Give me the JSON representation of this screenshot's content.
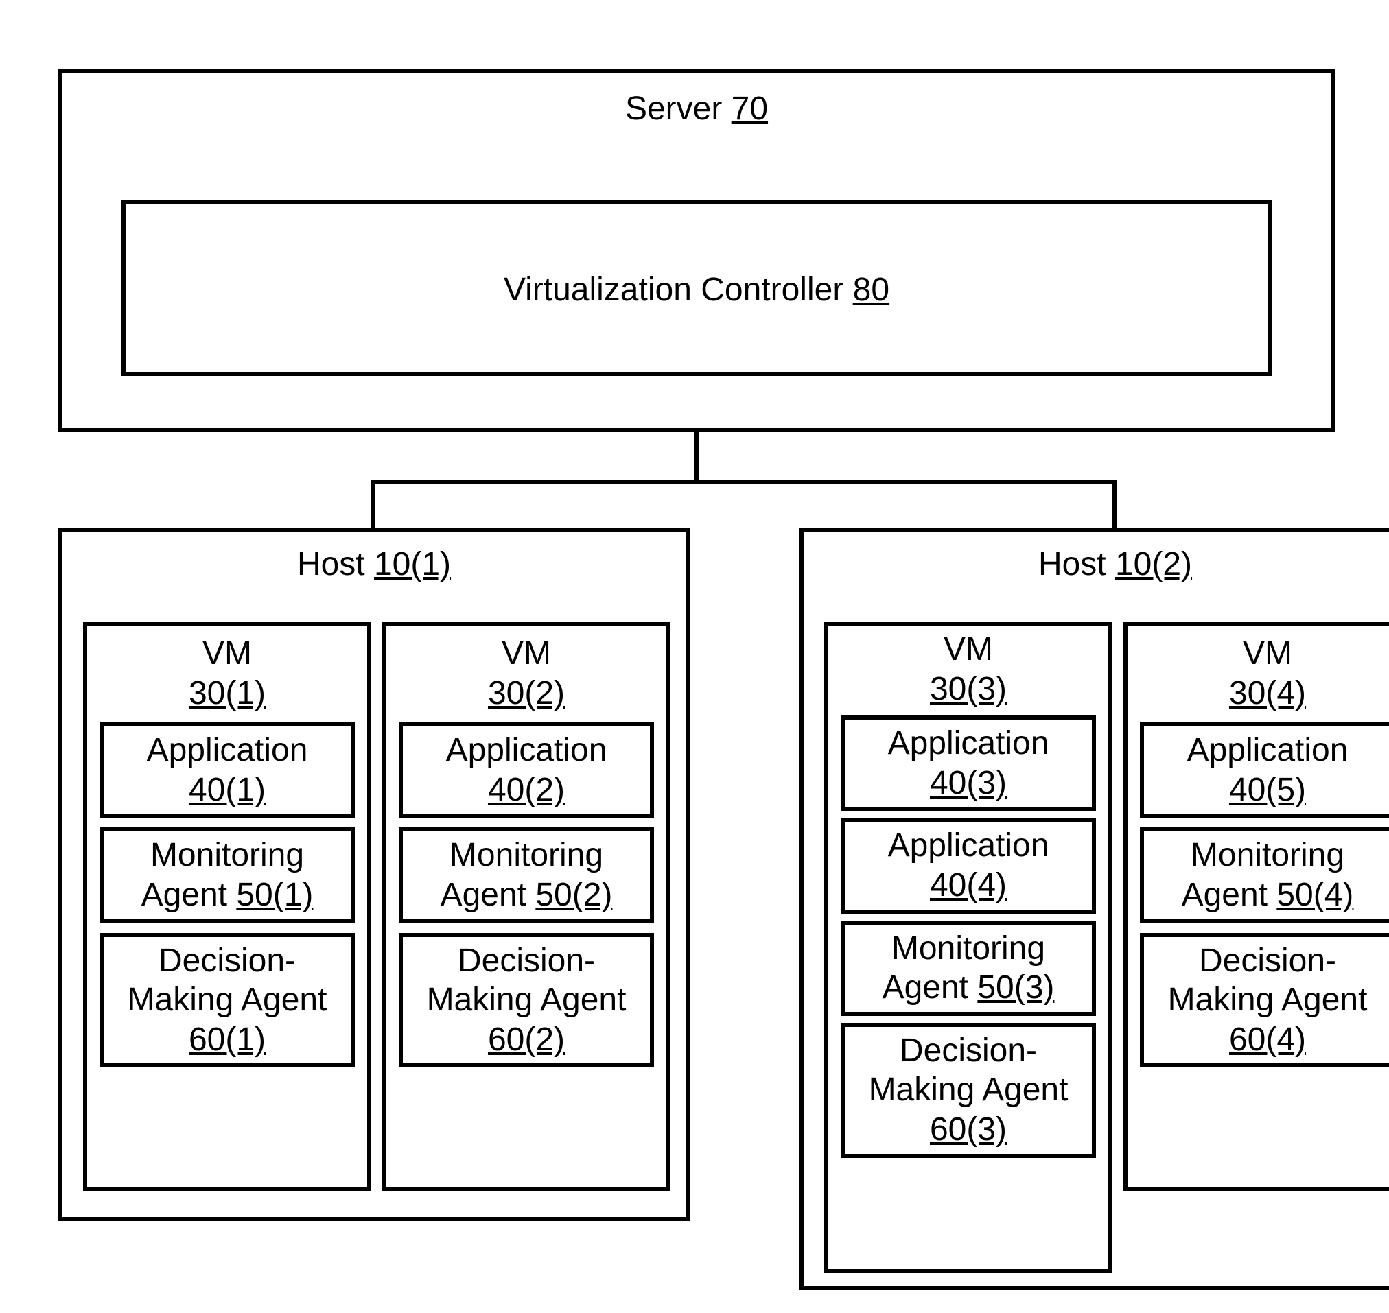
{
  "server": {
    "label": "Server",
    "ref": "70"
  },
  "controller": {
    "label": "Virtualization Controller",
    "ref": "80"
  },
  "hosts": [
    {
      "label": "Host",
      "ref": "10(1)",
      "vms": [
        {
          "label": "VM",
          "ref": "30(1)",
          "components": [
            {
              "label": "Application",
              "ref": "40(1)"
            },
            {
              "label_a": "Monitoring",
              "label_b": "Agent",
              "ref": "50(1)"
            },
            {
              "label_a": "Decision-",
              "label_b": "Making Agent",
              "ref": "60(1)"
            }
          ]
        },
        {
          "label": "VM",
          "ref": "30(2)",
          "components": [
            {
              "label": "Application",
              "ref": "40(2)"
            },
            {
              "label_a": "Monitoring",
              "label_b": "Agent",
              "ref": "50(2)"
            },
            {
              "label_a": "Decision-",
              "label_b": "Making Agent",
              "ref": "60(2)"
            }
          ]
        }
      ]
    },
    {
      "label": "Host",
      "ref": "10(2)",
      "vms": [
        {
          "label": "VM",
          "ref": "30(3)",
          "components": [
            {
              "label": "Application",
              "ref": "40(3)"
            },
            {
              "label": "Application",
              "ref": "40(4)"
            },
            {
              "label_a": "Monitoring",
              "label_b": "Agent",
              "ref": "50(3)"
            },
            {
              "label_a": "Decision-",
              "label_b": "Making Agent",
              "ref": "60(3)"
            }
          ]
        },
        {
          "label": "VM",
          "ref": "30(4)",
          "components": [
            {
              "label": "Application",
              "ref": "40(5)"
            },
            {
              "label_a": "Monitoring",
              "label_b": "Agent",
              "ref": "50(4)"
            },
            {
              "label_a": "Decision-",
              "label_b": "Making Agent",
              "ref": "60(4)"
            }
          ]
        }
      ]
    }
  ]
}
